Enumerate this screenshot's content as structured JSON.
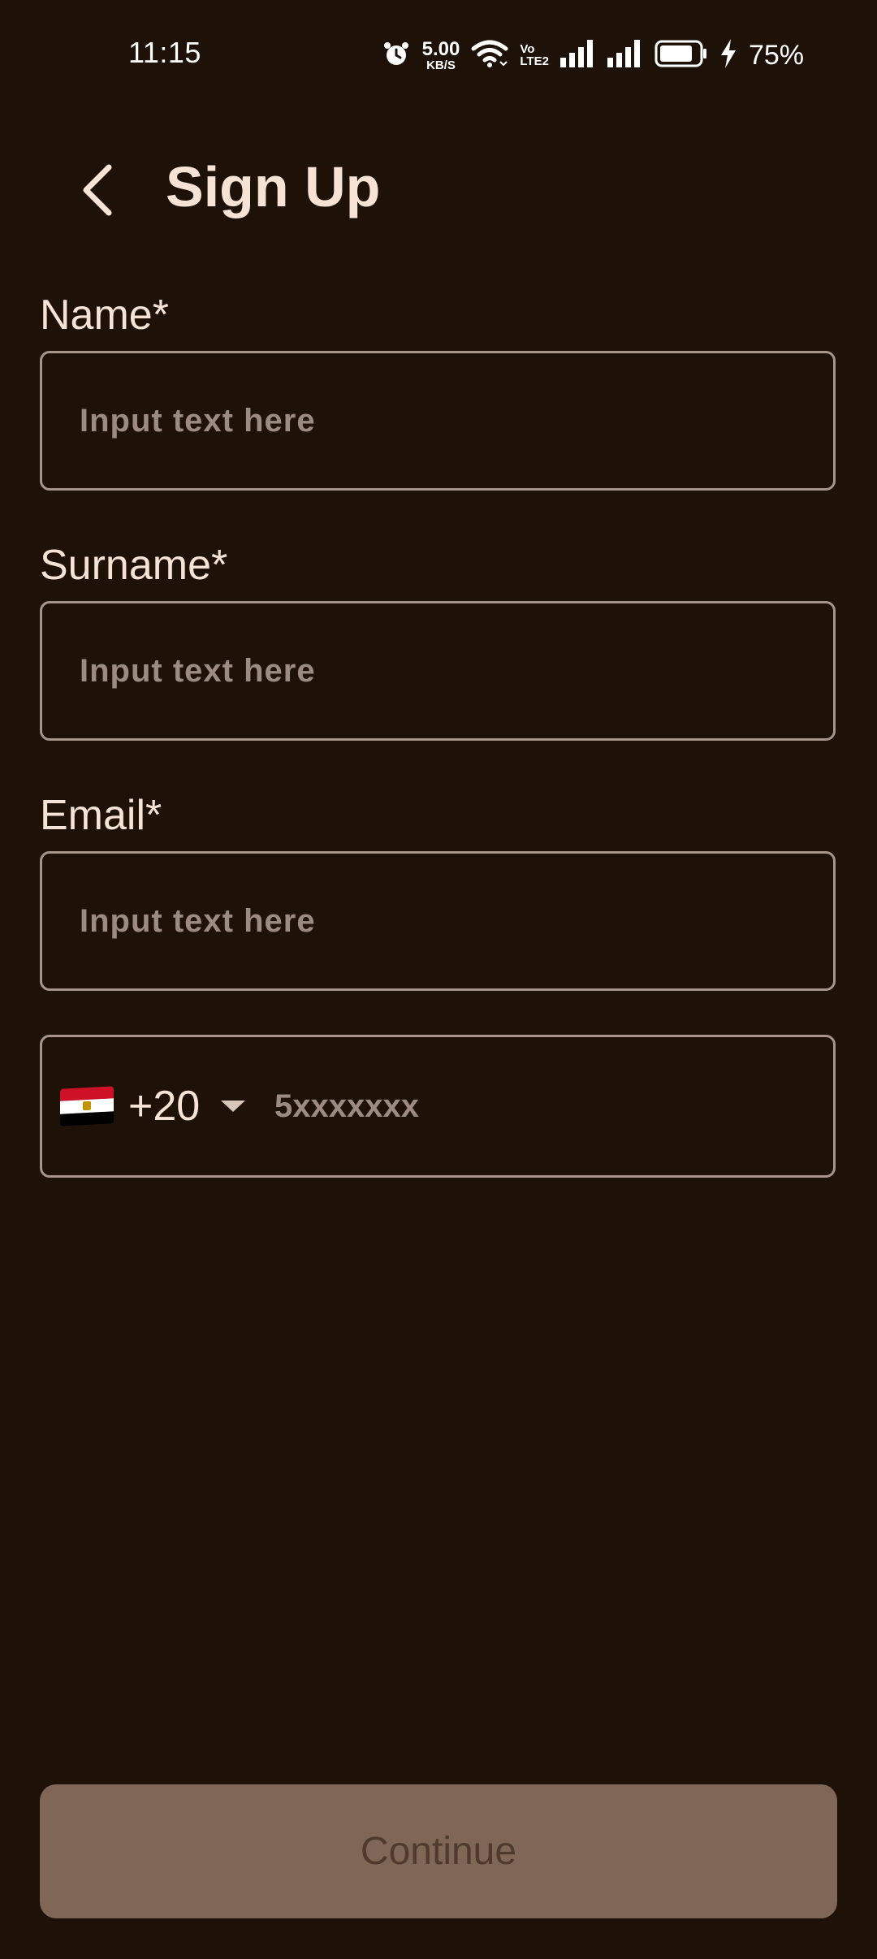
{
  "status_bar": {
    "time": "11:15",
    "net_speed_value": "5.00",
    "net_speed_unit": "KB/S",
    "volte_top": "Vo",
    "volte_bottom": "LTE2",
    "battery_percent": "75%",
    "icons": [
      "alarm-icon",
      "wifi-icon",
      "signal-icon",
      "signal-icon",
      "battery-icon",
      "charging-icon"
    ]
  },
  "header": {
    "title": "Sign Up",
    "back_icon": "chevron-left-icon"
  },
  "form": {
    "name": {
      "label": "Name*",
      "placeholder": "Input text here",
      "value": ""
    },
    "surname": {
      "label": "Surname*",
      "placeholder": "Input text here",
      "value": ""
    },
    "email": {
      "label": "Email*",
      "placeholder": "Input text here",
      "value": ""
    },
    "phone": {
      "country_flag": "egypt-flag-icon",
      "dial_code": "+20",
      "placeholder": "5xxxxxxx",
      "value": ""
    }
  },
  "actions": {
    "continue_label": "Continue",
    "continue_enabled": false
  },
  "colors": {
    "background": "#1d1108",
    "text": "#f6e3d6",
    "border": "#a7958b",
    "placeholder": "#9c8b80",
    "button_disabled_bg": "#7f6657",
    "button_disabled_text": "#4f3a2e"
  }
}
